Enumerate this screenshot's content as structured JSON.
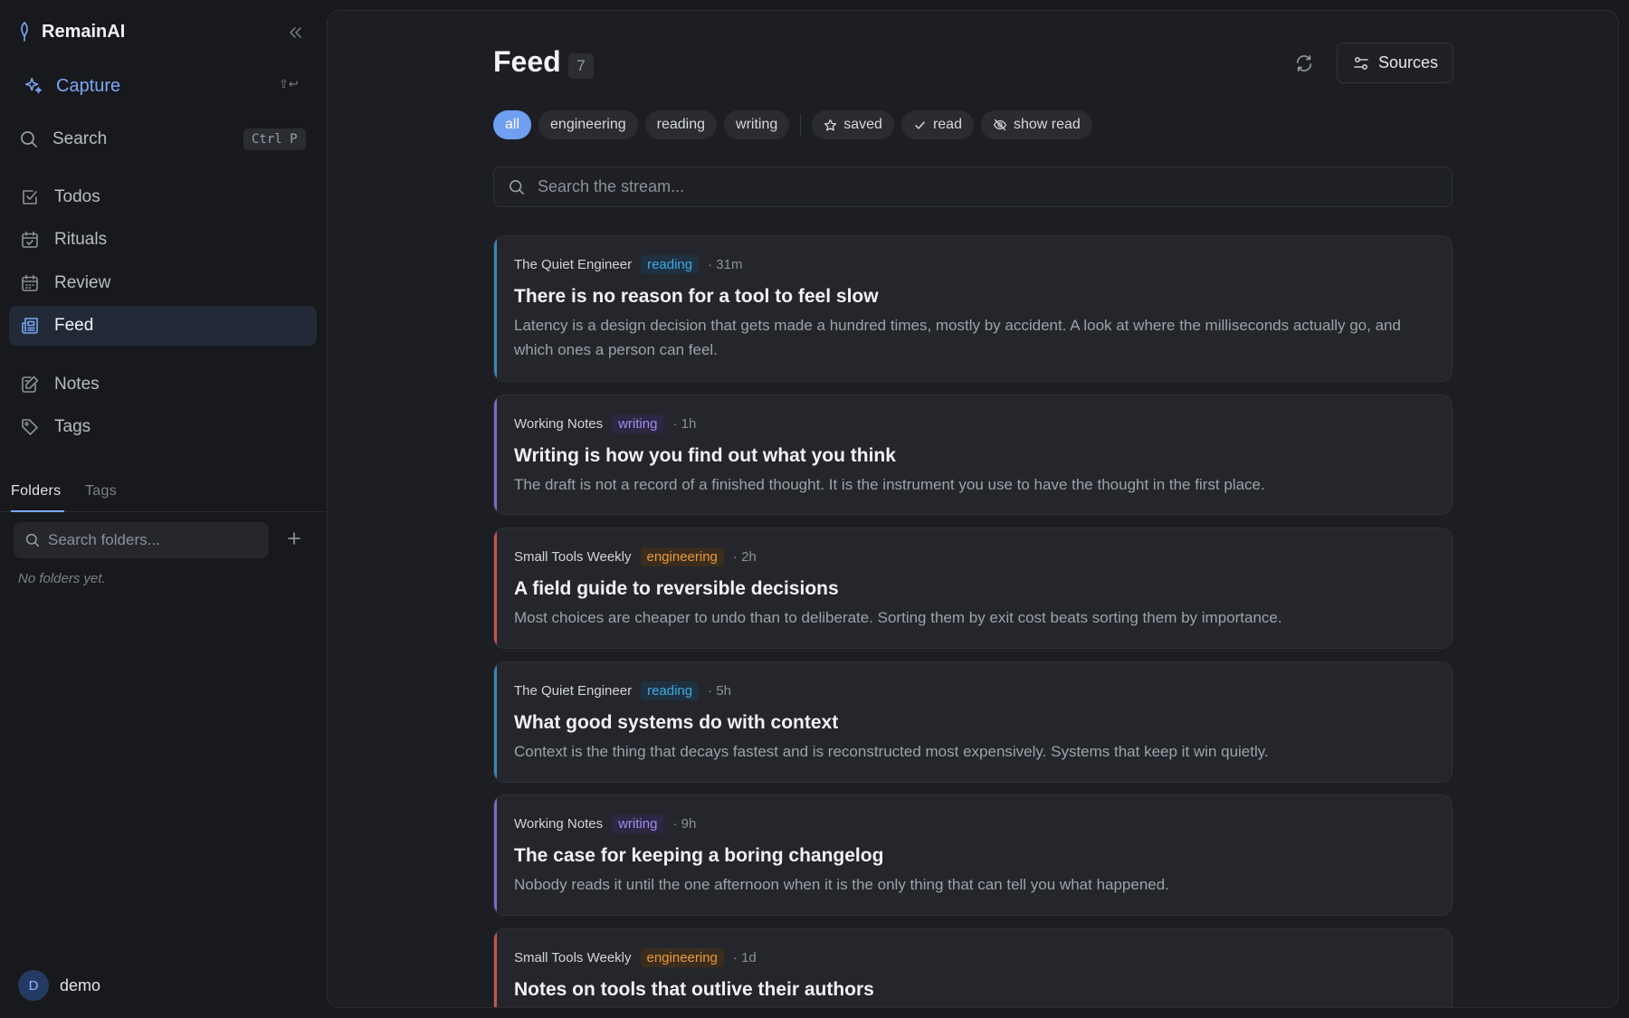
{
  "app": {
    "name": "RemainAI"
  },
  "sidebar": {
    "capture": {
      "label": "Capture",
      "shortcut": "⇧↩"
    },
    "search": {
      "label": "Search",
      "shortcut": "Ctrl P"
    },
    "nav": [
      {
        "label": "Todos",
        "icon": "square-check-icon"
      },
      {
        "label": "Rituals",
        "icon": "calendar-check-icon"
      },
      {
        "label": "Review",
        "icon": "calendar-icon"
      },
      {
        "label": "Feed",
        "icon": "newspaper-icon",
        "active": true
      },
      {
        "label": "Notes",
        "icon": "note-edit-icon"
      },
      {
        "label": "Tags",
        "icon": "tag-icon"
      }
    ],
    "tabs": [
      {
        "label": "Folders",
        "active": true
      },
      {
        "label": "Tags"
      }
    ],
    "folder_search_placeholder": "Search folders...",
    "empty_folders": "No folders yet.",
    "user": {
      "initial": "D",
      "name": "demo"
    }
  },
  "main": {
    "title": "Feed",
    "count": "7",
    "sources_label": "Sources",
    "filters": {
      "tags": [
        {
          "label": "all",
          "active": true
        },
        {
          "label": "engineering"
        },
        {
          "label": "reading"
        },
        {
          "label": "writing"
        }
      ],
      "toggles": [
        {
          "label": "saved",
          "icon": "star-icon"
        },
        {
          "label": "read",
          "icon": "check-icon"
        },
        {
          "label": "show read",
          "icon": "eye-off-icon"
        }
      ]
    },
    "search_placeholder": "Search the stream...",
    "tag_colors": {
      "reading": {
        "text": "#3fa9e0",
        "bg": "#1e3141",
        "bar": "#3a86b8"
      },
      "writing": {
        "text": "#a58af0",
        "bg": "#2c2742",
        "bar": "#7f69c9"
      },
      "engineering": {
        "text": "#e89a3c",
        "bg": "#3a2d1d",
        "bar": "#c0564e"
      }
    },
    "cards": [
      {
        "source": "The Quiet Engineer",
        "tag": "reading",
        "time": "· 31m",
        "title": "There is no reason for a tool to feel slow",
        "summary": "Latency is a design decision that gets made a hundred times, mostly by accident. A look at where the milliseconds actually go, and which ones a person can feel."
      },
      {
        "source": "Working Notes",
        "tag": "writing",
        "time": "· 1h",
        "title": "Writing is how you find out what you think",
        "summary": "The draft is not a record of a finished thought. It is the instrument you use to have the thought in the first place."
      },
      {
        "source": "Small Tools Weekly",
        "tag": "engineering",
        "time": "· 2h",
        "title": "A field guide to reversible decisions",
        "summary": "Most choices are cheaper to undo than to deliberate. Sorting them by exit cost beats sorting them by importance."
      },
      {
        "source": "The Quiet Engineer",
        "tag": "reading",
        "time": "· 5h",
        "title": "What good systems do with context",
        "summary": "Context is the thing that decays fastest and is reconstructed most expensively. Systems that keep it win quietly."
      },
      {
        "source": "Working Notes",
        "tag": "writing",
        "time": "· 9h",
        "title": "The case for keeping a boring changelog",
        "summary": "Nobody reads it until the one afternoon when it is the only thing that can tell you what happened."
      },
      {
        "source": "Small Tools Weekly",
        "tag": "engineering",
        "time": "· 1d",
        "title": "Notes on tools that outlive their authors",
        "summary": ""
      }
    ]
  }
}
